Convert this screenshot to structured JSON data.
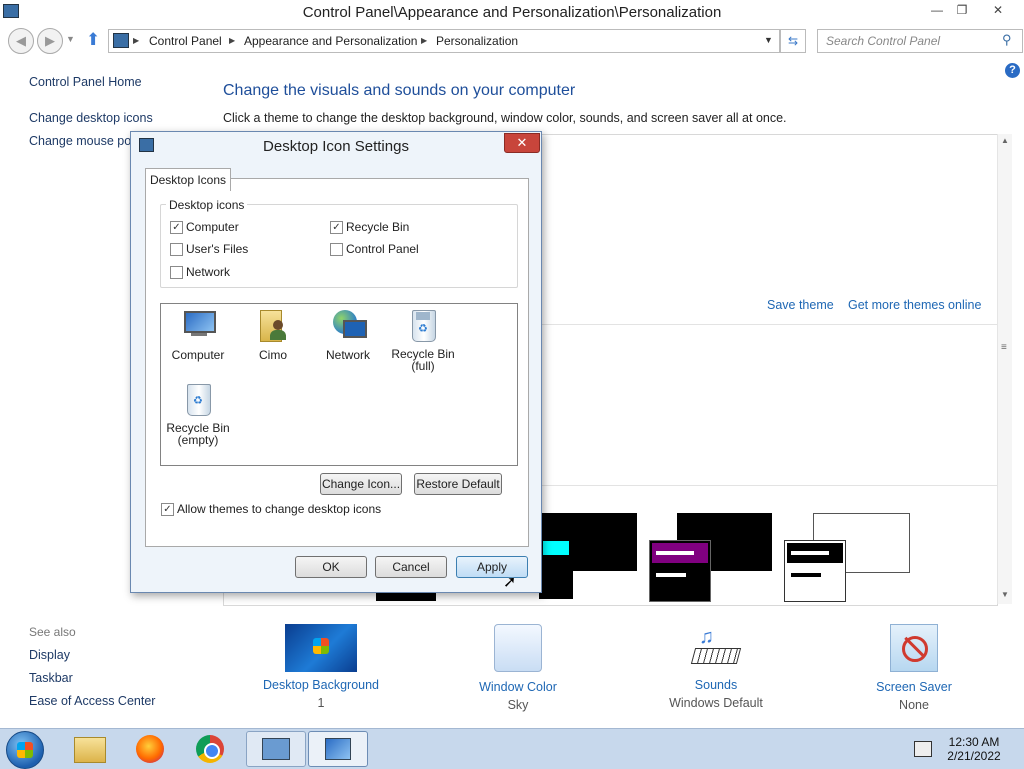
{
  "window": {
    "title": "Control Panel\\Appearance and Personalization\\Personalization",
    "minimize": "—",
    "restore": "❐",
    "close": "✕"
  },
  "address": {
    "segments": [
      "Control Panel",
      "Appearance and Personalization",
      "Personalization"
    ],
    "search_placeholder": "Search Control Panel"
  },
  "left_pane": {
    "links": [
      "Control Panel Home",
      "Change desktop icons",
      "Change mouse pointers"
    ],
    "see_also_title": "See also",
    "see_also": [
      "Display",
      "Taskbar",
      "Ease of Access Center"
    ]
  },
  "content": {
    "heading": "Change the visuals and sounds on your computer",
    "subtext": "Click a theme to change the desktop background, window color, sounds, and screen saver all at once.",
    "save_theme": "Save theme",
    "get_more": "Get more themes online",
    "bottom_items": [
      {
        "label": "Desktop Background",
        "value": "1"
      },
      {
        "label": "Window Color",
        "value": "Sky"
      },
      {
        "label": "Sounds",
        "value": "Windows Default"
      },
      {
        "label": "Screen Saver",
        "value": "None"
      }
    ]
  },
  "dialog": {
    "title": "Desktop Icon Settings",
    "close": "✕",
    "tab": "Desktop Icons",
    "group_title": "Desktop icons",
    "checkboxes": [
      {
        "label": "Computer",
        "checked": true
      },
      {
        "label": "Recycle Bin",
        "checked": true
      },
      {
        "label": "User's Files",
        "checked": false
      },
      {
        "label": "Control Panel",
        "checked": false
      },
      {
        "label": "Network",
        "checked": false
      }
    ],
    "icons": [
      {
        "label": "Computer",
        "icon": "computer-icon"
      },
      {
        "label": "Cimo",
        "icon": "user-folder-icon"
      },
      {
        "label": "Network",
        "icon": "network-icon"
      },
      {
        "label": "Recycle Bin\n(full)",
        "icon": "recycle-bin-full-icon"
      },
      {
        "label": "Recycle Bin\n(empty)",
        "icon": "recycle-bin-empty-icon"
      }
    ],
    "change_icon": "Change Icon...",
    "restore_default": "Restore Default",
    "allow_themes": "Allow themes to change desktop icons",
    "allow_themes_checked": true,
    "ok": "OK",
    "cancel": "Cancel",
    "apply": "Apply"
  },
  "taskbar": {
    "time": "12:30 AM",
    "date": "2/21/2022"
  }
}
